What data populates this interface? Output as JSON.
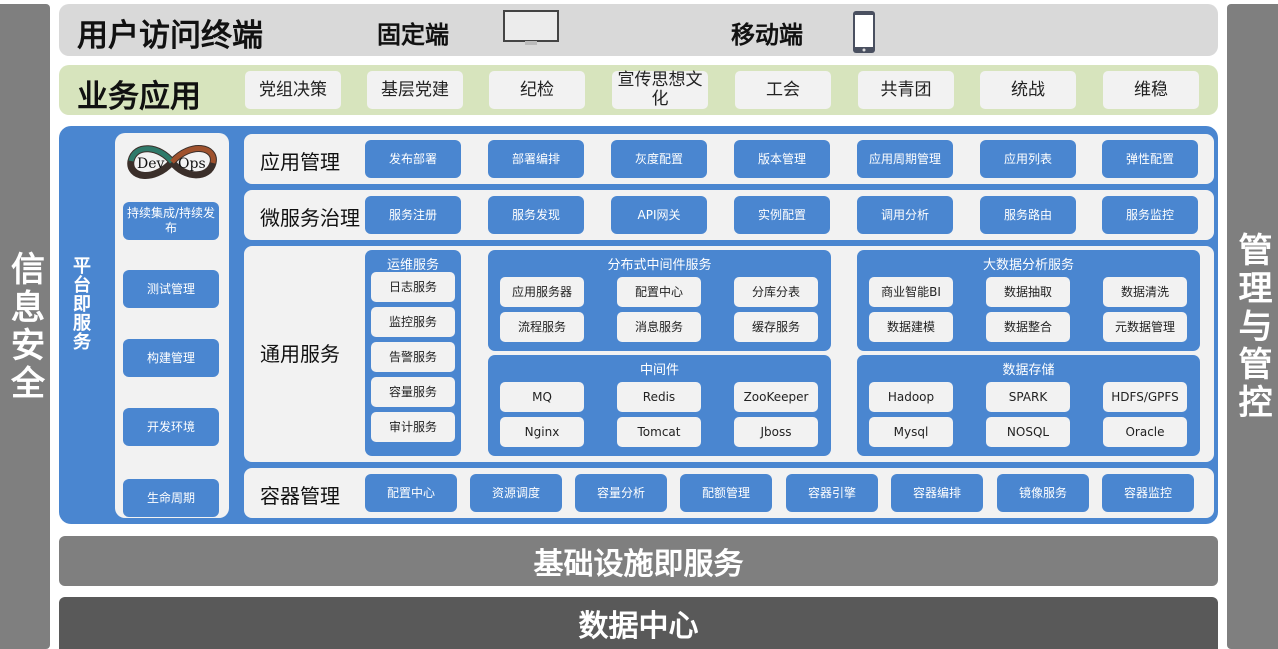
{
  "left_bar": {
    "label": "信息安全"
  },
  "right_bar": {
    "label": "管理与管控"
  },
  "access_layer": {
    "title": "用户访问终端",
    "fixed_label": "固定端",
    "fixed_icon": "monitor-icon",
    "mobile_label": "移动端",
    "mobile_icon": "phone-icon"
  },
  "business_layer": {
    "title": "业务应用",
    "items": [
      "党组决策",
      "基层党建",
      "纪检",
      "宣传思想文化",
      "工会",
      "共青团",
      "统战",
      "维稳"
    ]
  },
  "paas": {
    "label": "平台即服务",
    "devops": {
      "logo_text_left": "Dev",
      "logo_text_right": "Ops",
      "items": [
        "持续集成/持续发布",
        "测试管理",
        "构建管理",
        "开发环境",
        "生命周期"
      ]
    },
    "app_mgmt": {
      "title": "应用管理",
      "items": [
        "发布部署",
        "部署编排",
        "灰度配置",
        "版本管理",
        "应用周期管理",
        "应用列表",
        "弹性配置"
      ]
    },
    "microservice": {
      "title": "微服务治理",
      "items": [
        "服务注册",
        "服务发现",
        "API网关",
        "实例配置",
        "调用分析",
        "服务路由",
        "服务监控"
      ]
    },
    "common": {
      "title": "通用服务",
      "ops": {
        "title": "运维服务",
        "items": [
          "日志服务",
          "监控服务",
          "告警服务",
          "容量服务",
          "审计服务"
        ]
      },
      "dist_middleware": {
        "title": "分布式中间件服务",
        "items": [
          "应用服务器",
          "配置中心",
          "分库分表",
          "流程服务",
          "消息服务",
          "缓存服务"
        ]
      },
      "middleware": {
        "title": "中间件",
        "items": [
          "MQ",
          "Redis",
          "ZooKeeper",
          "Nginx",
          "Tomcat",
          "Jboss"
        ]
      },
      "bigdata": {
        "title": "大数据分析服务",
        "items": [
          "商业智能BI",
          "数据抽取",
          "数据清洗",
          "数据建模",
          "数据整合",
          "元数据管理"
        ]
      },
      "storage": {
        "title": "数据存储",
        "items": [
          "Hadoop",
          "SPARK",
          "HDFS/GPFS",
          "Mysql",
          "NOSQL",
          "Oracle"
        ]
      }
    },
    "container": {
      "title": "容器管理",
      "items": [
        "配置中心",
        "资源调度",
        "容量分析",
        "配额管理",
        "容器引擎",
        "容器编排",
        "镜像服务",
        "容器监控"
      ]
    }
  },
  "iaas": {
    "label": "基础设施即服务"
  },
  "datacenter": {
    "label": "数据中心"
  },
  "colors": {
    "accent_blue": "#4a86d0",
    "panel_gray": "#f2f2f2",
    "side_gray": "#7f7f7f",
    "biz_green": "#d7e4bd",
    "access_gray": "#d9d9d9",
    "dc_dark": "#595959"
  }
}
